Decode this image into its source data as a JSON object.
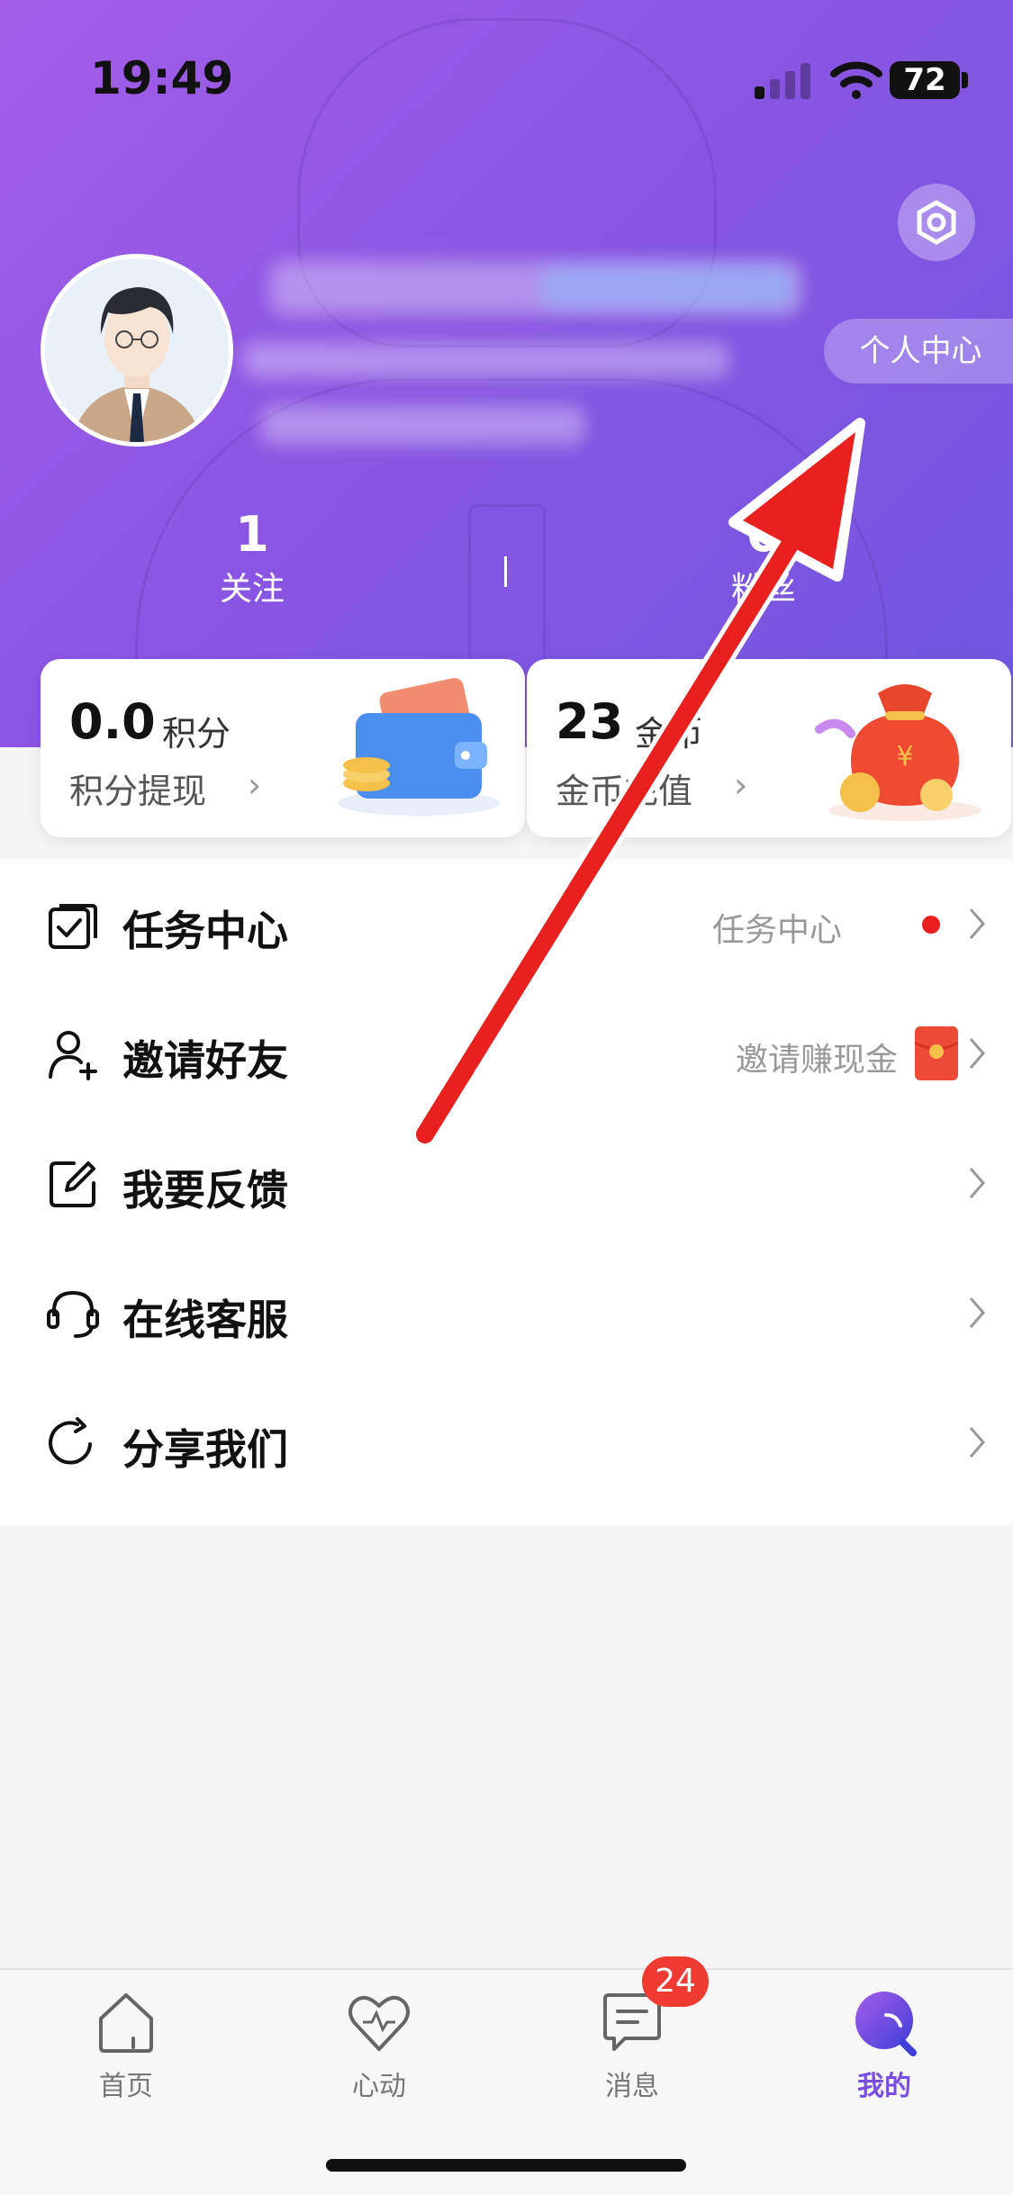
{
  "status_bar": {
    "time": "19:49",
    "battery": "72"
  },
  "header": {
    "personal_center": "个人中心"
  },
  "stats": [
    {
      "value": "1",
      "label": "关注"
    },
    {
      "value": "0",
      "label": "粉丝"
    }
  ],
  "cards": {
    "points": {
      "value": "0.0",
      "unit": "积分",
      "link": "积分提现"
    },
    "coins": {
      "value": "23",
      "unit": "金币",
      "link": "金币充值"
    }
  },
  "menu": [
    {
      "label": "任务中心",
      "right": "任务中心",
      "icon": "task-check-icon"
    },
    {
      "label": "邀请好友",
      "right": "邀请赚现金",
      "icon": "add-user-icon"
    },
    {
      "label": "我要反馈",
      "right": "",
      "icon": "edit-icon"
    },
    {
      "label": "在线客服",
      "right": "",
      "icon": "headset-icon"
    },
    {
      "label": "分享我们",
      "right": "",
      "icon": "share-icon"
    }
  ],
  "tabs": [
    {
      "label": "首页",
      "icon": "home-icon"
    },
    {
      "label": "心动",
      "icon": "heart-icon"
    },
    {
      "label": "消息",
      "icon": "message-icon"
    },
    {
      "label": "我的",
      "icon": "profile-icon"
    }
  ],
  "badge": "24",
  "colors": {
    "accent": "#7a4ee0",
    "header_start": "#a45ee8",
    "header_end": "#6f57e0",
    "badge": "#ef3b32",
    "arrow": "#e8201e"
  }
}
